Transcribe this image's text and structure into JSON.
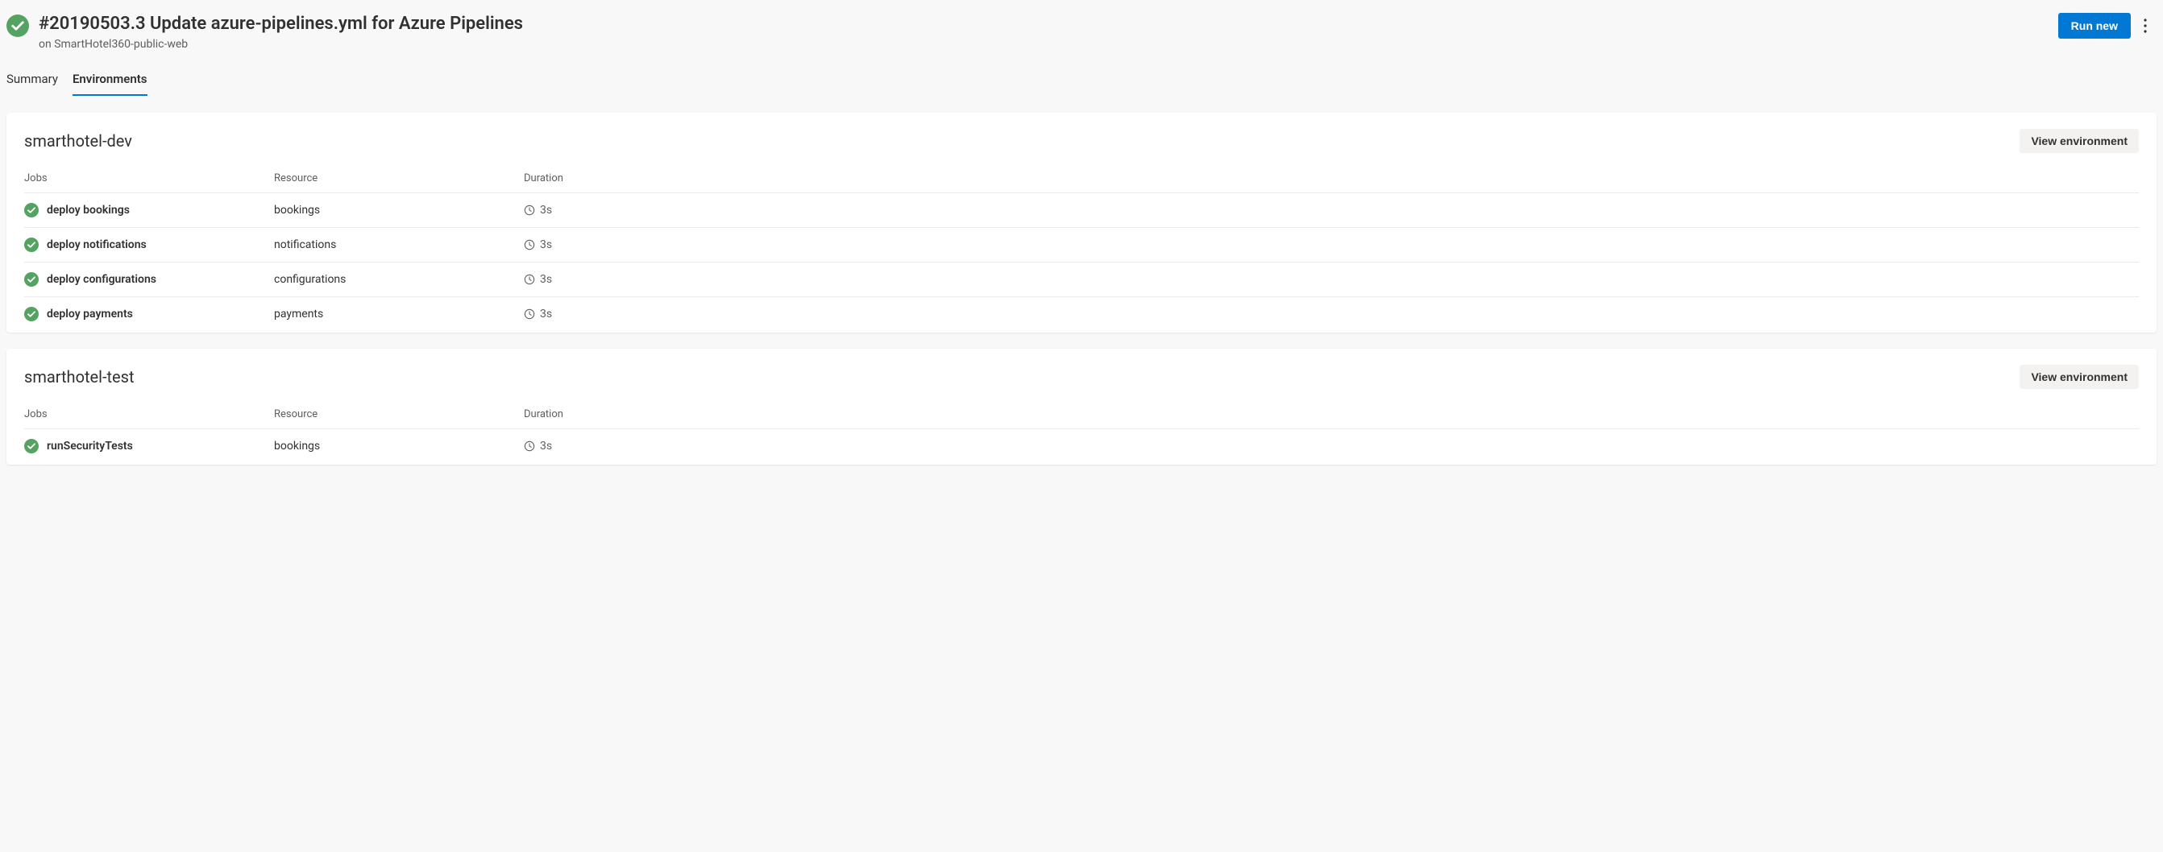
{
  "header": {
    "title": "#20190503.3 Update azure-pipelines.yml for Azure Pipelines",
    "subtitle": "on SmartHotel360-public-web",
    "run_new_label": "Run new"
  },
  "tabs": [
    {
      "label": "Summary",
      "selected": false
    },
    {
      "label": "Environments",
      "selected": true
    }
  ],
  "columns": {
    "jobs": "Jobs",
    "resource": "Resource",
    "duration": "Duration"
  },
  "view_env_label": "View environment",
  "environments": [
    {
      "name": "smarthotel-dev",
      "jobs": [
        {
          "name": "deploy bookings",
          "resource": "bookings",
          "duration": "3s"
        },
        {
          "name": "deploy notifications",
          "resource": "notifications",
          "duration": "3s"
        },
        {
          "name": "deploy configurations",
          "resource": "configurations",
          "duration": "3s"
        },
        {
          "name": "deploy payments",
          "resource": "payments",
          "duration": "3s"
        }
      ]
    },
    {
      "name": "smarthotel-test",
      "jobs": [
        {
          "name": "runSecurityTests",
          "resource": "bookings",
          "duration": "3s"
        }
      ]
    }
  ]
}
